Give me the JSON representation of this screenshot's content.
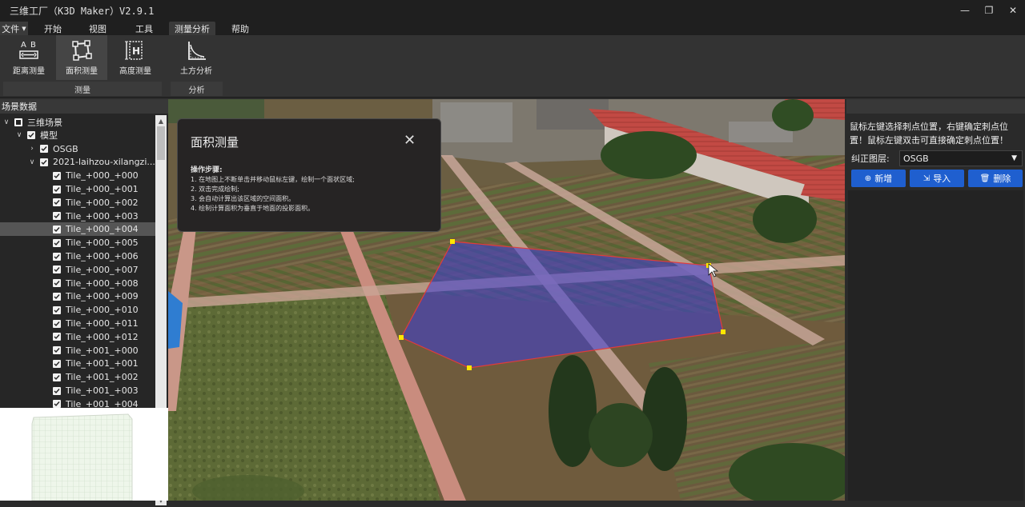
{
  "window": {
    "title": "三维工厂（K3D Maker）V2.9.1",
    "min": "—",
    "max": "❐",
    "close": "✕"
  },
  "menu": {
    "file": "文件",
    "items": [
      "开始",
      "视图",
      "工具",
      "测量分析",
      "帮助"
    ],
    "active": "测量分析"
  },
  "ribbon": {
    "buttons": [
      {
        "label": "距离测量",
        "icon": "distance-measure-icon"
      },
      {
        "label": "面积测量",
        "icon": "area-measure-icon"
      },
      {
        "label": "高度测量",
        "icon": "height-measure-icon"
      },
      {
        "label": "土方分析",
        "icon": "earthwork-analysis-icon"
      }
    ],
    "groups": [
      "测量",
      "分析"
    ]
  },
  "left_panel": {
    "title": "场景数据",
    "tree": [
      {
        "label": "三维场景",
        "level": 0,
        "arrow": "v",
        "check": "partial"
      },
      {
        "label": "模型",
        "level": 1,
        "arrow": "v",
        "check": "checked"
      },
      {
        "label": "OSGB",
        "level": 2,
        "arrow": ">",
        "check": "checked"
      },
      {
        "label": "2021-laihzou-xilangzi...",
        "level": 2,
        "arrow": "v",
        "check": "checked"
      },
      {
        "label": "Tile_+000_+000",
        "level": 3,
        "check": "checked"
      },
      {
        "label": "Tile_+000_+001",
        "level": 3,
        "check": "checked"
      },
      {
        "label": "Tile_+000_+002",
        "level": 3,
        "check": "checked"
      },
      {
        "label": "Tile_+000_+003",
        "level": 3,
        "check": "checked"
      },
      {
        "label": "Tile_+000_+004",
        "level": 3,
        "check": "checked",
        "selected": true
      },
      {
        "label": "Tile_+000_+005",
        "level": 3,
        "check": "checked"
      },
      {
        "label": "Tile_+000_+006",
        "level": 3,
        "check": "checked"
      },
      {
        "label": "Tile_+000_+007",
        "level": 3,
        "check": "checked"
      },
      {
        "label": "Tile_+000_+008",
        "level": 3,
        "check": "checked"
      },
      {
        "label": "Tile_+000_+009",
        "level": 3,
        "check": "checked"
      },
      {
        "label": "Tile_+000_+010",
        "level": 3,
        "check": "checked"
      },
      {
        "label": "Tile_+000_+011",
        "level": 3,
        "check": "checked"
      },
      {
        "label": "Tile_+000_+012",
        "level": 3,
        "check": "checked"
      },
      {
        "label": "Tile_+001_+000",
        "level": 3,
        "check": "checked"
      },
      {
        "label": "Tile_+001_+001",
        "level": 3,
        "check": "checked"
      },
      {
        "label": "Tile_+001_+002",
        "level": 3,
        "check": "checked"
      },
      {
        "label": "Tile_+001_+003",
        "level": 3,
        "check": "checked"
      },
      {
        "label": "Tile_+001_+004",
        "level": 3,
        "check": "checked"
      }
    ]
  },
  "popup": {
    "title": "面积测量",
    "close": "✕",
    "steps_title": "操作步骤:",
    "steps": [
      "1. 在地图上不断单击并移动鼠标左键，绘制一个面状区域;",
      "2. 双击完成绘制;",
      "3. 会自动计算出该区域的空间面积。",
      "4. 绘制计算面积为垂直于地面的投影面积。"
    ]
  },
  "right_panel": {
    "instruction": "鼠标左键选择刺点位置，右键确定刺点位置！鼠标左键双击可直接确定刺点位置！",
    "layer_label": "纠正图层:",
    "layer_value": "OSGB",
    "buttons": [
      "新增",
      "导入",
      "删除"
    ]
  },
  "colors": {
    "accent": "#1f5fcf",
    "polygon_fill": "#3a3dd8",
    "polygon_edge": "#e23b3b",
    "vertex": "#ffe600"
  }
}
